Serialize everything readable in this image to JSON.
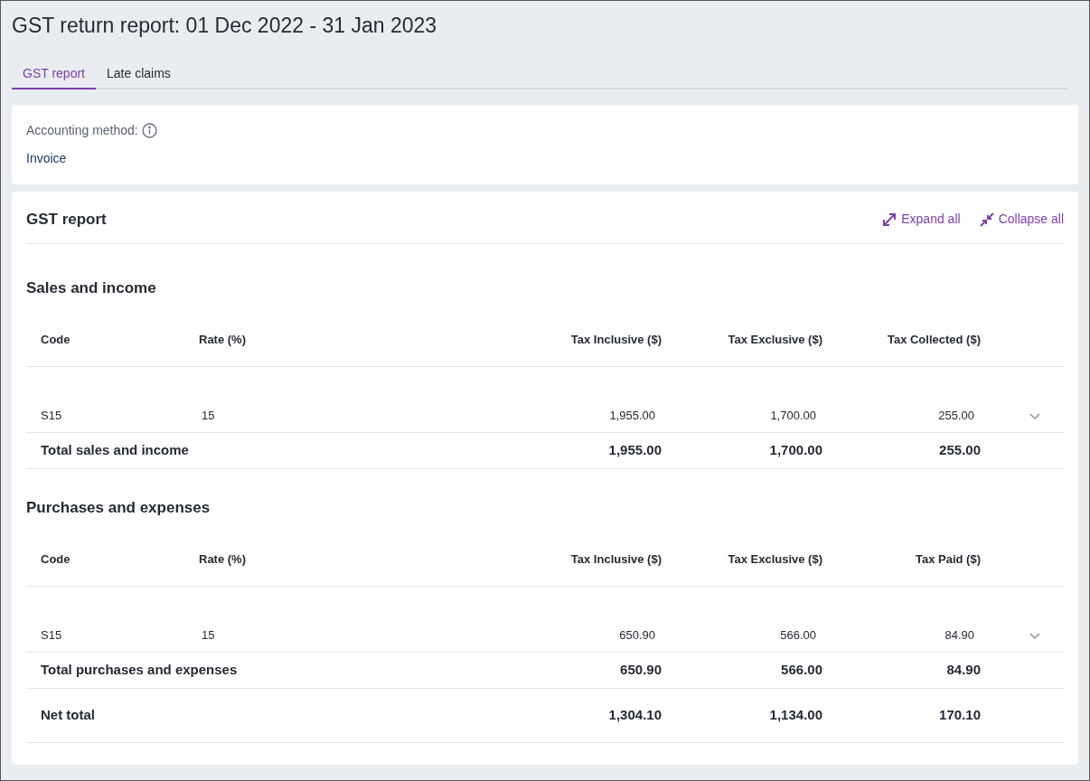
{
  "page_title": "GST return report: 01 Dec 2022 - 31 Jan 2023",
  "tabs": [
    {
      "label": "GST report",
      "selected": true
    },
    {
      "label": "Late claims",
      "selected": false
    }
  ],
  "accounting": {
    "label": "Accounting method:",
    "value": "Invoice"
  },
  "report": {
    "title": "GST report",
    "expand_all": "Expand all",
    "collapse_all": "Collapse all",
    "sections": [
      {
        "title": "Sales and income",
        "columns": [
          "Code",
          "Rate (%)",
          "Tax Inclusive ($)",
          "Tax Exclusive ($)",
          "Tax Collected ($)"
        ],
        "rows": [
          {
            "cells": [
              "S15",
              "15",
              "1,955.00",
              "1,700.00",
              "255.00"
            ],
            "expanded": false
          }
        ],
        "total": {
          "label": "Total sales and income",
          "values": [
            "1,955.00",
            "1,700.00",
            "255.00"
          ]
        }
      },
      {
        "title": "Purchases and expenses",
        "columns": [
          "Code",
          "Rate (%)",
          "Tax Inclusive ($)",
          "Tax Exclusive ($)",
          "Tax Paid ($)"
        ],
        "rows": [
          {
            "cells": [
              "S15",
              "15",
              "650.90",
              "566.00",
              "84.90"
            ],
            "expanded": false
          }
        ],
        "total": {
          "label": "Total purchases and expenses",
          "values": [
            "650.90",
            "566.00",
            "84.90"
          ]
        }
      }
    ],
    "net_total": {
      "label": "Net total",
      "values": [
        "1,304.10",
        "1,134.00",
        "170.10"
      ]
    }
  }
}
